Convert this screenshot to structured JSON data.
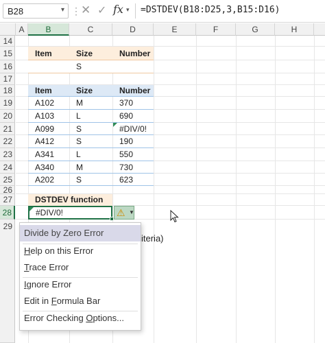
{
  "formula_bar": {
    "name_box": "B28",
    "formula": "=DSTDEV(B18:D25,3,B15:D16)"
  },
  "columns": [
    "A",
    "B",
    "C",
    "D",
    "E",
    "F",
    "G",
    "H"
  ],
  "rows": [
    "14",
    "15",
    "16",
    "17",
    "18",
    "19",
    "20",
    "21",
    "22",
    "23",
    "24",
    "25",
    "26",
    "27",
    "28",
    "29"
  ],
  "criteria_table": {
    "headers": [
      "Item",
      "Size",
      "Number"
    ],
    "row": [
      "",
      "S",
      ""
    ]
  },
  "data_table": {
    "headers": [
      "Item",
      "Size",
      "Number"
    ],
    "rows": [
      [
        "A102",
        "M",
        "370"
      ],
      [
        "A103",
        "L",
        "690"
      ],
      [
        "A099",
        "S",
        "#DIV/0!"
      ],
      [
        "A412",
        "S",
        "190"
      ],
      [
        "A341",
        "L",
        "550"
      ],
      [
        "A340",
        "M",
        "730"
      ],
      [
        "A202",
        "S",
        "623"
      ]
    ]
  },
  "result": {
    "label": "DSTDEV function",
    "value": "#DIV/0!"
  },
  "behind_menu_text": "iteria)",
  "error_menu": {
    "title": "Divide by Zero Error",
    "items": [
      {
        "pre": "",
        "u": "H",
        "post": "elp on this Error"
      },
      {
        "pre": "",
        "u": "T",
        "post": "race Error"
      },
      {
        "pre": "",
        "u": "I",
        "post": "gnore Error"
      },
      {
        "pre": "Edit in ",
        "u": "F",
        "post": "ormula Bar"
      },
      {
        "pre": "Error Checking ",
        "u": "O",
        "post": "ptions..."
      }
    ]
  },
  "icons": {
    "cancel": "close-icon",
    "enter": "checkmark-icon",
    "function": "fx-icon",
    "warning": "warning-icon",
    "pointer": "mouse-pointer-icon"
  },
  "colors": {
    "accent_green": "#1e7145",
    "criteria_header_fill": "#fdeedd",
    "data_header_fill": "#dde9f6",
    "menu_highlight": "#d9d9e9"
  }
}
